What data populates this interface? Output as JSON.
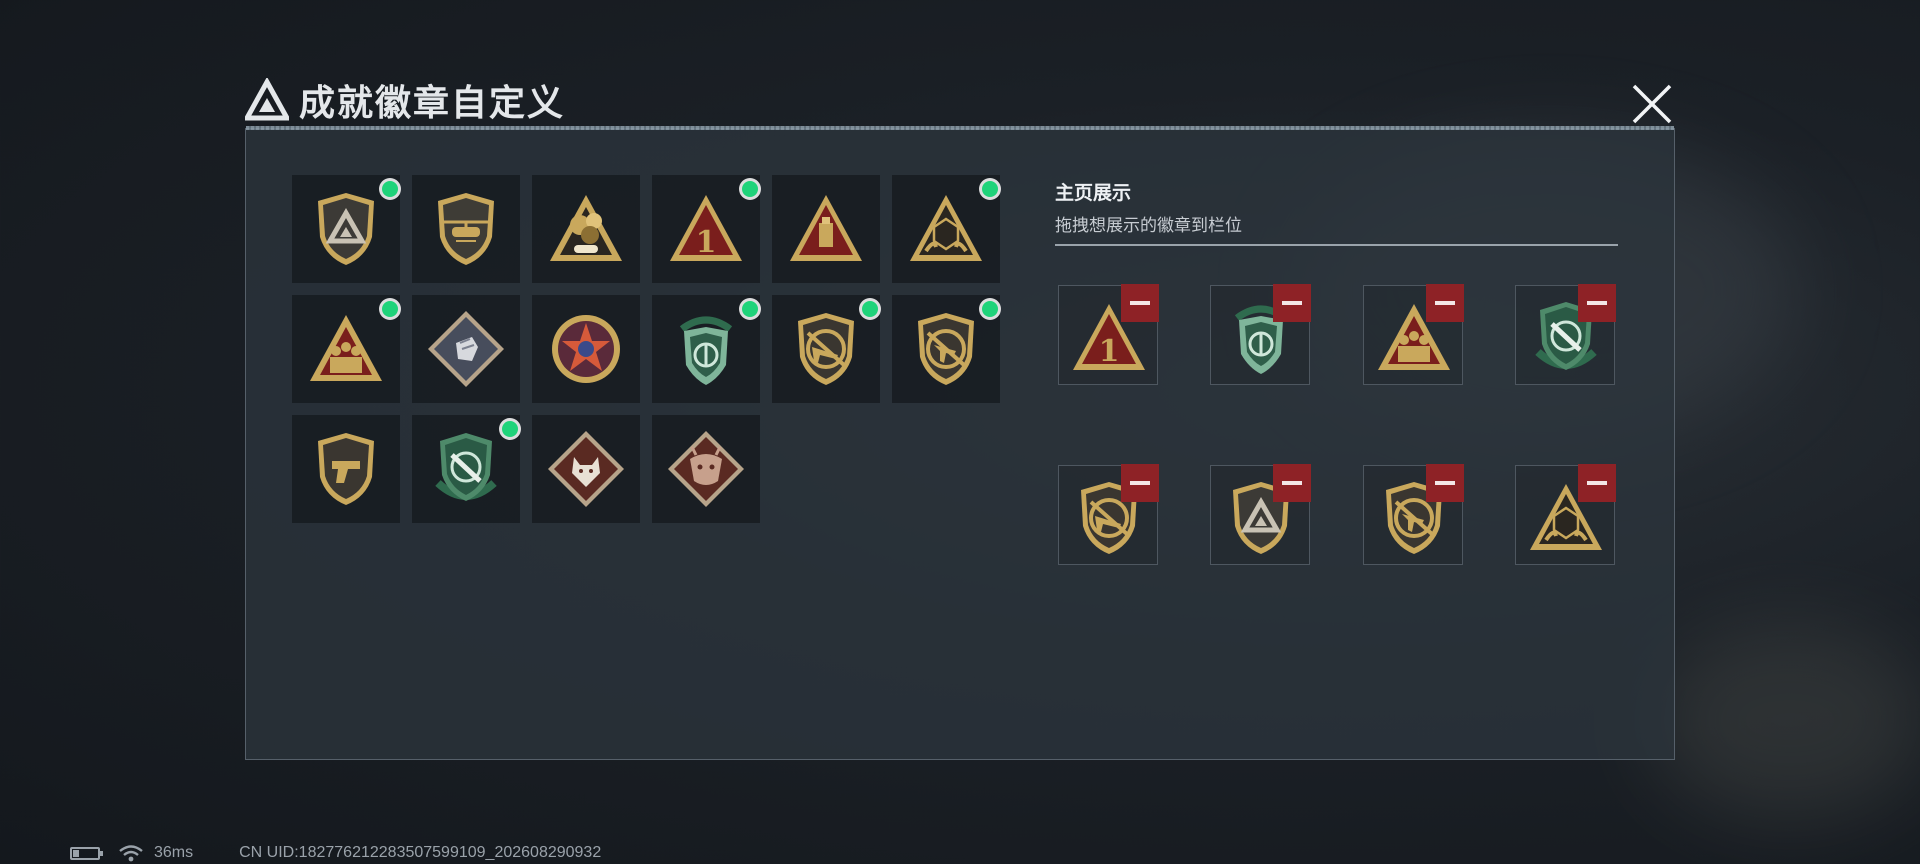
{
  "header": {
    "title": "成就徽章自定义",
    "close_icon": "close-icon"
  },
  "showcase": {
    "title": "主页展示",
    "subtitle": "拖拽想展示的徽章到栏位"
  },
  "badges": [
    {
      "icon": "shield-delta-emblem-icon",
      "equipped": true
    },
    {
      "icon": "helicopter-shield-icon",
      "equipped": false
    },
    {
      "icon": "gold-grenade-triangle-icon",
      "equipped": false
    },
    {
      "icon": "number-one-triangle-icon",
      "equipped": true
    },
    {
      "icon": "usb-drive-triangle-icon",
      "equipped": false
    },
    {
      "icon": "d20-dice-triangle-icon",
      "equipped": true
    },
    {
      "icon": "squad-soldiers-triangle-icon",
      "equipped": true
    },
    {
      "icon": "silver-fist-diamond-icon",
      "equipped": false
    },
    {
      "icon": "red-star-medal-icon",
      "equipped": false
    },
    {
      "icon": "green-emblem-shield-icon",
      "equipped": true
    },
    {
      "icon": "rifle-shield-icon",
      "equipped": true
    },
    {
      "icon": "smg-shield-icon",
      "equipped": true
    },
    {
      "icon": "pistol-shield-icon",
      "equipped": false
    },
    {
      "icon": "green-knife-crosshair-icon",
      "equipped": true
    },
    {
      "icon": "wolf-diamond-icon",
      "equipped": false
    },
    {
      "icon": "dragon-diamond-icon",
      "equipped": false
    }
  ],
  "slots": [
    {
      "icon": "number-one-triangle-icon"
    },
    {
      "icon": "green-emblem-shield-icon"
    },
    {
      "icon": "squad-soldiers-triangle-icon"
    },
    {
      "icon": "green-knife-crosshair-icon"
    },
    {
      "icon": "rifle-shield-icon"
    },
    {
      "icon": "shield-delta-emblem-icon"
    },
    {
      "icon": "smg-shield-icon"
    },
    {
      "icon": "d20-dice-triangle-icon"
    }
  ],
  "status": {
    "latency": "36ms",
    "uid": "CN UID:18277621228350759910​9_202608290932"
  },
  "colors": {
    "accent_green": "#1fd37a",
    "remove_red": "#8e2226",
    "gold": "#c9a85c"
  }
}
